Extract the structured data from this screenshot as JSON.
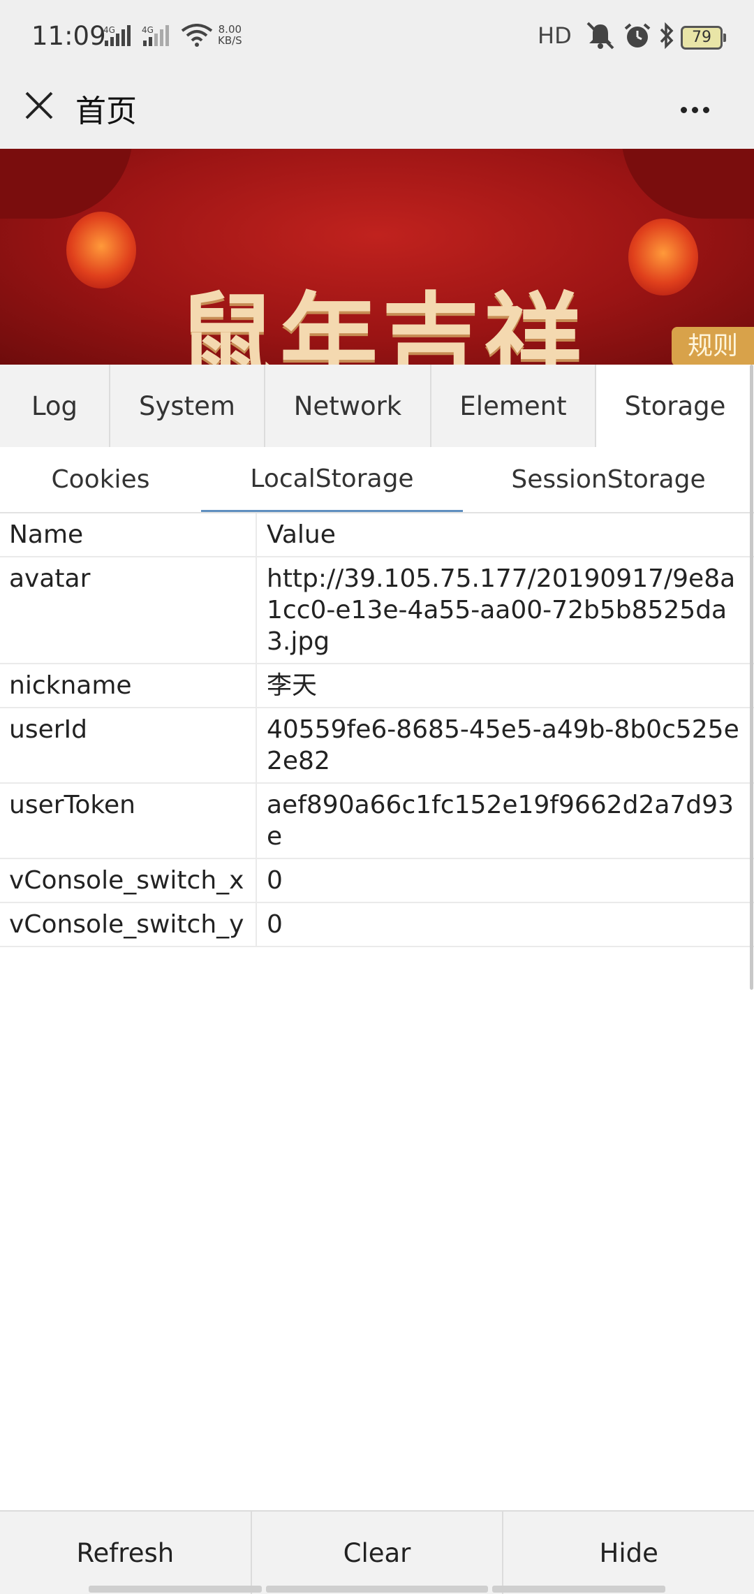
{
  "status_bar": {
    "time": "11:09",
    "signal1": "4G",
    "signal2": "4G",
    "speed_value": "8.00",
    "speed_unit": "KB/S",
    "hd": "HD",
    "battery": "79"
  },
  "header": {
    "title": "首页",
    "close_icon": "close-icon",
    "more_icon": "more-icon"
  },
  "banner": {
    "text": "鼠年吉祥",
    "badge": "规则"
  },
  "main_tabs": [
    {
      "label": "Log",
      "active": false
    },
    {
      "label": "System",
      "active": false
    },
    {
      "label": "Network",
      "active": false
    },
    {
      "label": "Element",
      "active": false
    },
    {
      "label": "Storage",
      "active": true
    }
  ],
  "sub_tabs": [
    {
      "label": "Cookies",
      "active": false
    },
    {
      "label": "LocalStorage",
      "active": true
    },
    {
      "label": "SessionStorage",
      "active": false
    }
  ],
  "table": {
    "headers": [
      "Name",
      "Value"
    ],
    "rows": [
      {
        "name": "avatar",
        "value": "http://39.105.75.177/20190917/9e8a1cc0-e13e-4a55-aa00-72b5b8525da3.jpg"
      },
      {
        "name": "nickname",
        "value": "李天"
      },
      {
        "name": "userId",
        "value": "40559fe6-8685-45e5-a49b-8b0c525e2e82"
      },
      {
        "name": "userToken",
        "value": "aef890a66c1fc152e19f9662d2a7d93e"
      },
      {
        "name": "vConsole_switch_x",
        "value": "0"
      },
      {
        "name": "vConsole_switch_y",
        "value": "0"
      }
    ]
  },
  "toolbar": {
    "refresh_label": "Refresh",
    "clear_label": "Clear",
    "hide_label": "Hide"
  },
  "colors": {
    "active_underline": "#5f8fbf",
    "chrome_bg": "#efefef",
    "banner_red": "#9b1414"
  }
}
